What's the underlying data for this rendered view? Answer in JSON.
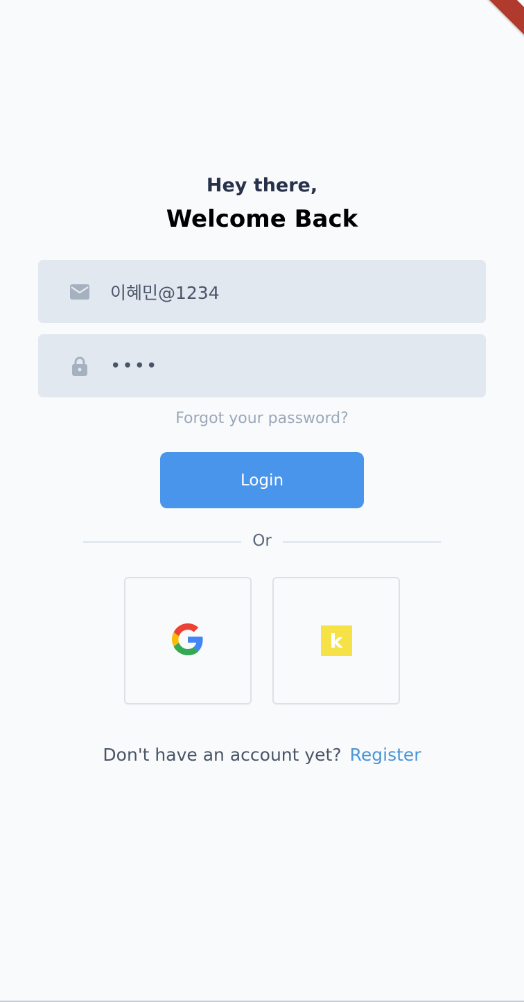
{
  "greeting": {
    "line1": "Hey there,",
    "line2": "Welcome Back"
  },
  "form": {
    "email_value": "이혜민@1234",
    "email_icon": "mail-icon",
    "password_value": "••••",
    "password_icon": "lock-icon"
  },
  "links": {
    "forgot": "Forgot your password?"
  },
  "buttons": {
    "login_label": "Login",
    "login_color": "#4a95ec"
  },
  "divider": {
    "label": "Or"
  },
  "social": {
    "google_icon": "google-icon",
    "kakao_icon": "kakao-icon",
    "kakao_letter": "k",
    "kakao_color": "#f6e146"
  },
  "footer": {
    "question": "Don't have an account yet?",
    "register": "Register"
  }
}
